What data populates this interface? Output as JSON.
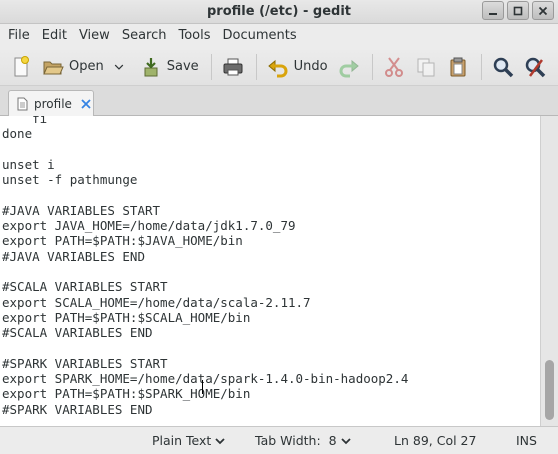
{
  "window": {
    "title": "profile (/etc) - gedit",
    "controls": {
      "minimize": "minimize-icon",
      "maximize": "maximize-icon",
      "close": "close-icon"
    }
  },
  "menu": [
    "File",
    "Edit",
    "View",
    "Search",
    "Tools",
    "Documents"
  ],
  "toolbar": {
    "new_icon": "new-document-icon",
    "open_label": "Open",
    "save_label": "Save",
    "undo_label": "Undo",
    "icons": [
      "print-icon",
      "redo-icon",
      "cut-icon",
      "copy-icon",
      "paste-icon",
      "find-icon",
      "replace-icon"
    ]
  },
  "tab": {
    "label": "profile"
  },
  "editor": {
    "lines": [
      "    fi",
      "done",
      "",
      "unset i",
      "unset -f pathmunge",
      "",
      "#JAVA VARIABLES START",
      "export JAVA_HOME=/home/data/jdk1.7.0_79",
      "export PATH=$PATH:$JAVA_HOME/bin",
      "#JAVA VARIABLES END",
      "",
      "#SCALA VARIABLES START",
      "export SCALA_HOME=/home/data/scala-2.11.7",
      "export PATH=$PATH:$SCALA_HOME/bin",
      "#SCALA VARIABLES END",
      "",
      "#SPARK VARIABLES START",
      "export SPARK_HOME=/home/data/spark-1.4.0-bin-hadoop2.4",
      "export PATH=$PATH:$SPARK_HOME/bin",
      "#SPARK VARIABLES END"
    ]
  },
  "status": {
    "language": "Plain Text",
    "tab_width": "Tab Width:  8",
    "position": "Ln 89, Col 27",
    "mode": "INS"
  }
}
